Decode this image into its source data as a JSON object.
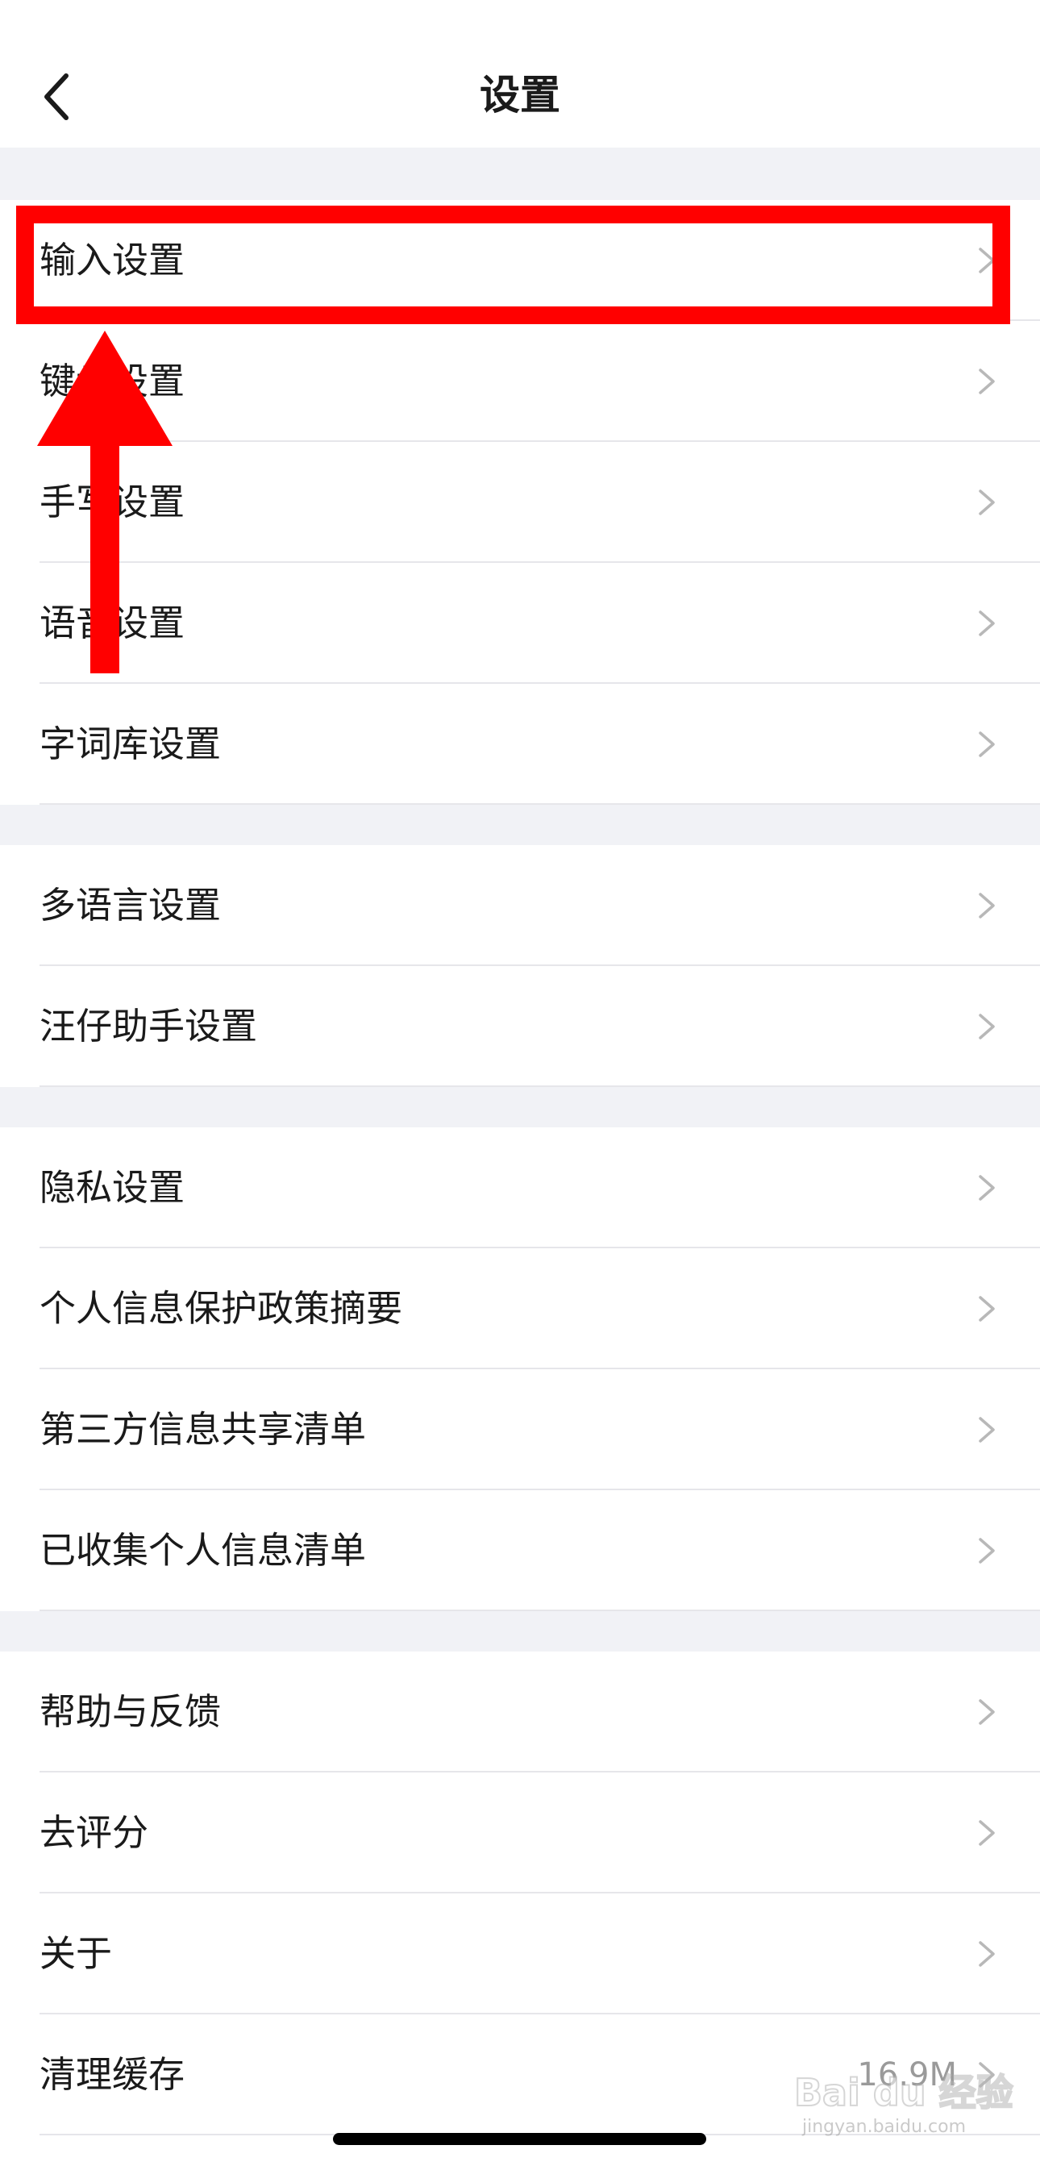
{
  "header": {
    "title": "设置",
    "back_icon": "chevron-left-icon"
  },
  "groups": [
    {
      "items": [
        {
          "label": "输入设置"
        },
        {
          "label": "键盘设置"
        },
        {
          "label": "手写设置"
        },
        {
          "label": "语音设置"
        },
        {
          "label": "字词库设置"
        }
      ]
    },
    {
      "items": [
        {
          "label": "多语言设置"
        },
        {
          "label": "汪仔助手设置"
        }
      ]
    },
    {
      "items": [
        {
          "label": "隐私设置"
        },
        {
          "label": "个人信息保护政策摘要"
        },
        {
          "label": "第三方信息共享清单"
        },
        {
          "label": "已收集个人信息清单"
        }
      ]
    },
    {
      "items": [
        {
          "label": "帮助与反馈"
        },
        {
          "label": "去评分"
        },
        {
          "label": "关于"
        },
        {
          "label": "清理缓存",
          "value": "16.9M"
        }
      ]
    }
  ],
  "row_icon": "chevron-right-icon",
  "annotation": {
    "highlight_color": "#ff0000",
    "highlight_target": "输入设置"
  },
  "watermark": {
    "main": "Bai du 经验",
    "sub": "jingyan.baidu.com"
  },
  "colors": {
    "background": "#f1f2f6",
    "row_background": "#ffffff",
    "text": "#1a1a1a",
    "secondary_text": "#9a9a9a",
    "chevron": "#b8b8b8",
    "annotation": "#ff0000"
  }
}
